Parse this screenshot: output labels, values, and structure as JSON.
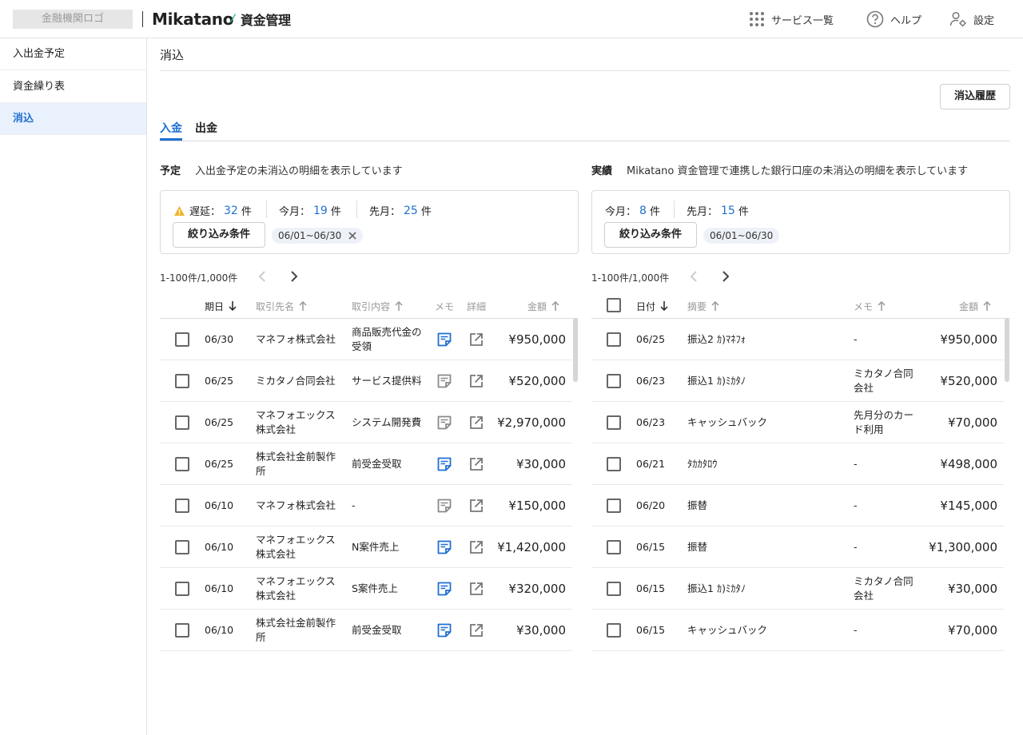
{
  "header": {
    "bank_logo": "金融機関ロゴ",
    "brand": "Mikatano",
    "brand_mark": "⁄",
    "product": "資金管理",
    "nav": {
      "services": "サービス一覧",
      "help": "ヘルプ",
      "settings": "設定"
    }
  },
  "sidebar": {
    "items": [
      {
        "label": "入出金予定"
      },
      {
        "label": "資金繰り表"
      },
      {
        "label": "消込"
      }
    ]
  },
  "page": {
    "title": "消込",
    "history_button": "消込履歴"
  },
  "tabs": [
    {
      "label": "入金"
    },
    {
      "label": "出金"
    }
  ],
  "left": {
    "label": "予定",
    "description": "入出金予定の未消込の明細を表示しています",
    "stats": {
      "overdue_label": "遅延：",
      "overdue": "32",
      "this_month_label": "今月：",
      "this_month": "19",
      "last_month_label": "先月：",
      "last_month": "25",
      "unit": "件"
    },
    "filter_button": "絞り込み条件",
    "filter_chip": "06/01~06/30",
    "pager": "1-100件/1,000件",
    "columns": {
      "date": "期日",
      "partner": "取引先名",
      "content": "取引内容",
      "memo": "メモ",
      "detail": "詳細",
      "amount": "金額"
    },
    "rows": [
      {
        "date": "06/30",
        "partner": "マネフォ株式会社",
        "content": "商品販売代金の受領",
        "memo_filled": true,
        "amount": "¥950,000"
      },
      {
        "date": "06/25",
        "partner": "ミカタノ合同会社",
        "content": "サービス提供料",
        "memo_filled": false,
        "amount": "¥520,000"
      },
      {
        "date": "06/25",
        "partner": "マネフォエックス株式会社",
        "content": "システム開発費",
        "memo_filled": false,
        "amount": "¥2,970,000"
      },
      {
        "date": "06/25",
        "partner": "株式会社金前製作所",
        "content": "前受金受取",
        "memo_filled": true,
        "amount": "¥30,000"
      },
      {
        "date": "06/10",
        "partner": "マネフォ株式会社",
        "content": "-",
        "memo_filled": false,
        "amount": "¥150,000"
      },
      {
        "date": "06/10",
        "partner": "マネフォエックス株式会社",
        "content": "N案件売上",
        "memo_filled": true,
        "amount": "¥1,420,000"
      },
      {
        "date": "06/10",
        "partner": "マネフォエックス株式会社",
        "content": "S案件売上",
        "memo_filled": true,
        "amount": "¥320,000"
      },
      {
        "date": "06/10",
        "partner": "株式会社金前製作所",
        "content": "前受金受取",
        "memo_filled": true,
        "amount": "¥30,000"
      }
    ]
  },
  "right": {
    "label": "実績",
    "description": "Mikatano 資金管理で連携した銀行口座の未消込の明細を表示しています",
    "stats": {
      "this_month_label": "今月：",
      "this_month": "8",
      "last_month_label": "先月：",
      "last_month": "15",
      "unit": "件"
    },
    "filter_button": "絞り込み条件",
    "filter_chip": "06/01~06/30",
    "pager": "1-100件/1,000件",
    "columns": {
      "date": "日付",
      "summary": "摘要",
      "memo": "メモ",
      "amount": "金額"
    },
    "rows": [
      {
        "date": "06/25",
        "summary": "振込2 ｶ)ﾏﾈﾌｫ",
        "memo": "-",
        "amount": "¥950,000"
      },
      {
        "date": "06/23",
        "summary": "振込1 ｶ)ﾐｶﾀﾉ",
        "memo": "ミカタノ合同会社",
        "amount": "¥520,000"
      },
      {
        "date": "06/23",
        "summary": "キャッシュバック",
        "memo": "先月分のカード利用",
        "amount": "¥70,000"
      },
      {
        "date": "06/21",
        "summary": "ﾀｶｶﾀﾛｳ",
        "memo": "-",
        "amount": "¥498,000"
      },
      {
        "date": "06/20",
        "summary": "振替",
        "memo": "-",
        "amount": "¥145,000"
      },
      {
        "date": "06/15",
        "summary": "振替",
        "memo": "-",
        "amount": "¥1,300,000"
      },
      {
        "date": "06/15",
        "summary": "振込1 ｶ)ﾐｶﾀﾉ",
        "memo": "ミカタノ合同会社",
        "amount": "¥30,000"
      },
      {
        "date": "06/15",
        "summary": "キャッシュバック",
        "memo": "-",
        "amount": "¥70,000"
      }
    ]
  },
  "colors": {
    "accent": "#1f6fd1",
    "warning": "#f0b429",
    "brand_mark": "#2dbb7c"
  }
}
